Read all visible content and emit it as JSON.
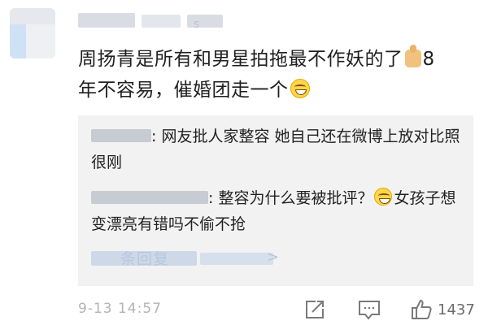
{
  "comment": {
    "author_tail": "s",
    "text_line1": "周扬青是所有和男星拍拖最不作妖的了",
    "emoji_1": "thumbs-up-icon",
    "text_line1_end": "8",
    "text_line2": "年不容易，催婚团走一个",
    "emoji_2": "grin-emoji-icon"
  },
  "replies": [
    {
      "separator": ":",
      "text": "网友批人家整容  她自己还在微博上放对比照  很刚"
    },
    {
      "separator": ":",
      "text_before_emoji": "整容为什么要被批评？",
      "emoji": "sweat-smile-emoji-icon",
      "text_after_emoji": "女孩子想变漂亮有错吗不偷不抢"
    }
  ],
  "more_replies": {
    "label": "条回复",
    "arrow": ">"
  },
  "footer": {
    "timestamp": "9-13 14:57",
    "like_count": "1437"
  },
  "colors": {
    "reply_bg": "#f2f2f2",
    "muted_text": "#b4b4b4",
    "link_blue": "#9fb4d3"
  }
}
